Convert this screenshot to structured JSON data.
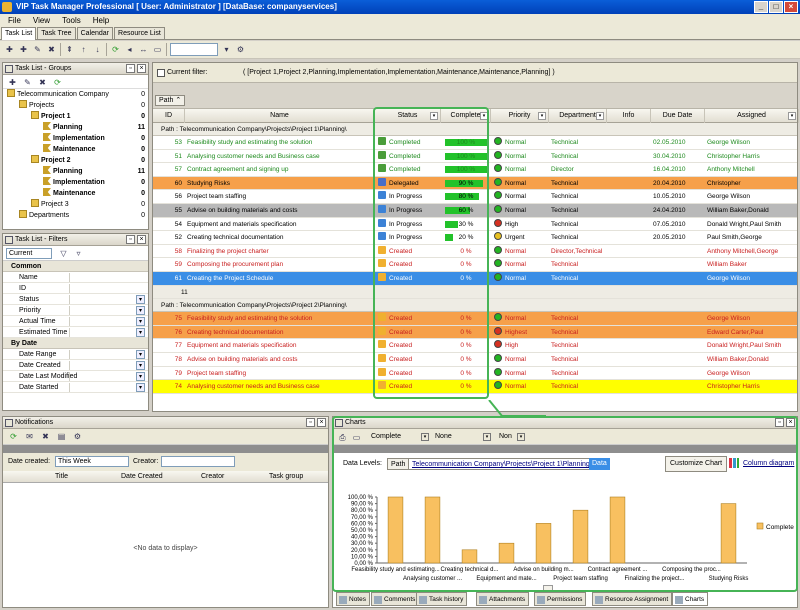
{
  "window": {
    "title": "VIP Task Manager Professional [ User: Administrator ] [DataBase: companyservices]"
  },
  "menu": [
    "File",
    "View",
    "Tools",
    "Help"
  ],
  "tabs": [
    "Task List",
    "Task Tree",
    "Calendar",
    "Resource List"
  ],
  "groups_panel": {
    "title": "Task List - Groups",
    "items": [
      {
        "label": "Telecommunication Company",
        "count": "0",
        "level": 0,
        "bold": false
      },
      {
        "label": "Projects",
        "count": "0",
        "level": 1,
        "bold": false
      },
      {
        "label": "Project 1",
        "count": "0",
        "level": 2,
        "bold": true
      },
      {
        "label": "Planning",
        "count": "11",
        "level": 3,
        "bold": true
      },
      {
        "label": "Implementation",
        "count": "0",
        "level": 3,
        "bold": true
      },
      {
        "label": "Maintenance",
        "count": "0",
        "level": 3,
        "bold": true
      },
      {
        "label": "Project 2",
        "count": "0",
        "level": 2,
        "bold": true
      },
      {
        "label": "Planning",
        "count": "11",
        "level": 3,
        "bold": true
      },
      {
        "label": "Implementation",
        "count": "0",
        "level": 3,
        "bold": true
      },
      {
        "label": "Maintenance",
        "count": "0",
        "level": 3,
        "bold": true
      },
      {
        "label": "Project 3",
        "count": "0",
        "level": 2,
        "bold": false
      },
      {
        "label": "Departments",
        "count": "0",
        "level": 1,
        "bold": false
      }
    ]
  },
  "filters_panel": {
    "title": "Task List - Filters",
    "combo": "Current",
    "cat1": "Common",
    "common": [
      "Name",
      "ID",
      "Status",
      "Priority",
      "Actual Time",
      "Estimated Time"
    ],
    "cat2": "By Date",
    "bydate": [
      "Date Range",
      "Date Created",
      "Date Last Modified",
      "Date Started"
    ]
  },
  "grid": {
    "filter_label": "Current filter:",
    "filter_text": "( [Project 1,Project 2,Planning,Implementation,Implementation,Maintenance,Maintenance,Planning] )",
    "group_chip": "Path",
    "columns": [
      "ID",
      "Name",
      "Status",
      "Complete",
      "Priority",
      "Department",
      "Info",
      "Due Date",
      "Assigned"
    ],
    "group1_caption": "Path : Telecommunication Company\\Projects\\Project 1\\Planning\\",
    "group2_caption": "Path : Telecommunication Company\\Projects\\Project 2\\Planning\\",
    "group1_count": "11",
    "rows1": [
      {
        "id": "53",
        "name": "Feasibility study and estimating the solution",
        "status": "Completed",
        "complete": 100,
        "complete_label": "100 %",
        "priority": "Normal",
        "dept": "Technical",
        "due": "02.05.2010",
        "assigned": "George Wilson",
        "fg": "#1d8a1d",
        "bg": "#ffffff",
        "pc": "#22b422"
      },
      {
        "id": "51",
        "name": "Analysing customer needs and Business case",
        "status": "Completed",
        "complete": 100,
        "complete_label": "100 %",
        "priority": "Normal",
        "dept": "Technical",
        "due": "30.04.2010",
        "assigned": "Christopher Harris",
        "fg": "#1d8a1d",
        "bg": "#ffffff",
        "pc": "#22b422"
      },
      {
        "id": "57",
        "name": "Contract agreement and signing up",
        "status": "Completed",
        "complete": 100,
        "complete_label": "100 %",
        "priority": "Normal",
        "dept": "Director",
        "due": "16.04.2010",
        "assigned": "Anthony Mitchell",
        "fg": "#1d8a1d",
        "bg": "#ffffff",
        "pc": "#22b422"
      },
      {
        "id": "60",
        "name": "Studying Risks",
        "status": "Delegated",
        "complete": 90,
        "complete_label": "90 %",
        "priority": "Normal",
        "dept": "Technical",
        "due": "20.04.2010",
        "assigned": "Christopher",
        "fg": "#000000",
        "bg": "#f6a04a",
        "pc": "#22b422"
      },
      {
        "id": "56",
        "name": "Project team staffing",
        "status": "In Progress",
        "complete": 80,
        "complete_label": "80 %",
        "priority": "Normal",
        "dept": "Technical",
        "due": "10.05.2010",
        "assigned": "George Wilson",
        "fg": "#000000",
        "bg": "#ffffff",
        "pc": "#22b422"
      },
      {
        "id": "55",
        "name": "Advise on building materials and costs",
        "status": "In Progress",
        "complete": 60,
        "complete_label": "60 %",
        "priority": "Normal",
        "dept": "Technical",
        "due": "24.04.2010",
        "assigned": "William Baker,Donald",
        "fg": "#000000",
        "bg": "#b9b9b9",
        "pc": "#22b422"
      },
      {
        "id": "54",
        "name": "Equipment and materials specification",
        "status": "In Progress",
        "complete": 30,
        "complete_label": "30 %",
        "priority": "High",
        "dept": "Technical",
        "due": "07.05.2010",
        "assigned": "Donald Wright,Paul Smith",
        "fg": "#000000",
        "bg": "#ffffff",
        "pc": "#d63020"
      },
      {
        "id": "52",
        "name": "Creating technical documentation",
        "status": "In Progress",
        "complete": 20,
        "complete_label": "20 %",
        "priority": "Urgent",
        "dept": "Technical",
        "due": "20.05.2010",
        "assigned": "Paul Smith,George",
        "fg": "#000000",
        "bg": "#ffffff",
        "pc": "#e8c020"
      },
      {
        "id": "58",
        "name": "Finalizing the project charter",
        "status": "Created",
        "complete": 0,
        "complete_label": "0 %",
        "priority": "Normal",
        "dept": "Director,Technical",
        "due": "",
        "assigned": "Anthony Mitchell,George",
        "fg": "#c81e1e",
        "bg": "#ffffff",
        "pc": "#22b422"
      },
      {
        "id": "59",
        "name": "Composing the procurement plan",
        "status": "Created",
        "complete": 0,
        "complete_label": "0 %",
        "priority": "Normal",
        "dept": "Technical",
        "due": "",
        "assigned": "William Baker",
        "fg": "#c81e1e",
        "bg": "#ffffff",
        "pc": "#22b422"
      },
      {
        "id": "61",
        "name": "Creating the Project Schedule",
        "status": "Created",
        "complete": 0,
        "complete_label": "0 %",
        "priority": "Normal",
        "dept": "Technical",
        "due": "",
        "assigned": "George Wilson",
        "fg": "#ffffff",
        "bg": "#3a8ee6",
        "pc": "#22b422"
      }
    ],
    "rows2": [
      {
        "id": "75",
        "name": "Feasibility study and estimating the solution",
        "status": "Created",
        "complete": 0,
        "complete_label": "0 %",
        "priority": "Normal",
        "dept": "Technical",
        "due": "",
        "assigned": "George Wilson",
        "fg": "#c81e1e",
        "bg": "#f6a04a",
        "pc": "#22b422"
      },
      {
        "id": "76",
        "name": "Creating technical documentation",
        "status": "Created",
        "complete": 0,
        "complete_label": "0 %",
        "priority": "Highest",
        "dept": "Technical",
        "due": "",
        "assigned": "Edward Carter,Paul",
        "fg": "#c81e1e",
        "bg": "#f6a04a",
        "pc": "#d63020"
      },
      {
        "id": "77",
        "name": "Equipment and materials specification",
        "status": "Created",
        "complete": 0,
        "complete_label": "0 %",
        "priority": "High",
        "dept": "Technical",
        "due": "",
        "assigned": "Donald Wright,Paul Smith",
        "fg": "#c81e1e",
        "bg": "#ffffff",
        "pc": "#d63020"
      },
      {
        "id": "78",
        "name": "Advise on building materials and costs",
        "status": "Created",
        "complete": 0,
        "complete_label": "0 %",
        "priority": "Normal",
        "dept": "Technical",
        "due": "",
        "assigned": "William Baker,Donald",
        "fg": "#c81e1e",
        "bg": "#ffffff",
        "pc": "#22b422"
      },
      {
        "id": "79",
        "name": "Project team staffing",
        "status": "Created",
        "complete": 0,
        "complete_label": "0 %",
        "priority": "Normal",
        "dept": "Technical",
        "due": "",
        "assigned": "George Wilson",
        "fg": "#c81e1e",
        "bg": "#ffffff",
        "pc": "#22b422"
      },
      {
        "id": "74",
        "name": "Analysing customer needs and Business case",
        "status": "Created",
        "complete": 0,
        "complete_label": "0 %",
        "priority": "Normal",
        "dept": "Technical",
        "due": "",
        "assigned": "Christopher Harris",
        "fg": "#c81e1e",
        "bg": "#ffff00",
        "pc": "#22b422"
      }
    ]
  },
  "notifications": {
    "title": "Notifications",
    "date_label": "Date created:",
    "date_value": "This Week",
    "creator_label": "Creator:",
    "columns": [
      "Title",
      "Date Created",
      "Creator",
      "Task group"
    ],
    "empty": "<No data to display>"
  },
  "charts": {
    "title": "Charts",
    "combo1": "Complete",
    "combo2": "None",
    "combo3": "Non",
    "levels_label": "Data Levels:",
    "path_chip": "Path",
    "path_value": "Telecommunication Company\\Projects\\Project 1\\Planning\\",
    "data_chip": "Data",
    "customize": "Customize Chart",
    "column_diagram": "Column diagram",
    "legend": "Complete"
  },
  "chart_data": {
    "type": "bar",
    "categories": [
      "Feasibility study and estimating...",
      "Analysing customer ...",
      "Creating technical d...",
      "Equipment and mate...",
      "Advise on building m...",
      "Project team staffing",
      "Contract agreement ...",
      "Finalizing the project...",
      "Composing the proc...",
      "Studying Risks"
    ],
    "values": [
      100,
      100,
      20,
      30,
      60,
      80,
      100,
      0,
      0,
      90
    ],
    "ylim": [
      0,
      100
    ],
    "yticks": [
      "0,00 %",
      "10,00 %",
      "20,00 %",
      "30,00 %",
      "40,00 %",
      "50,00 %",
      "60,00 %",
      "70,00 %",
      "80,00 %",
      "90,00 %",
      "100,00 %"
    ],
    "series": [
      {
        "name": "Complete"
      }
    ],
    "bar_color": "#f8c060"
  },
  "bottom_tabs": [
    "Notes",
    "Comments",
    "Task history",
    "Attachments",
    "Permissions",
    "Resource Assignment",
    "Charts"
  ]
}
